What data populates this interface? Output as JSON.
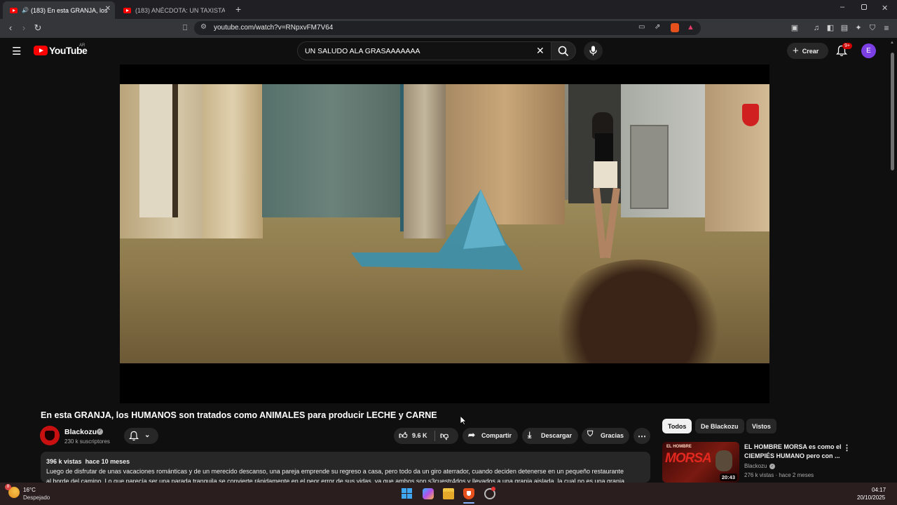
{
  "browser": {
    "tabs": [
      {
        "label": "(183) En esta GRANJA, los HU..."
      },
      {
        "label": "(183) ANÉCDOTA: UN TAXISTA MUY ..."
      }
    ],
    "url": "youtube.com/watch?v=RNpxvFM7V64"
  },
  "youtube": {
    "logo_text": "YouTube",
    "region": "AR",
    "search_query": "UN SALUDO ALA GRASAAAAAAA",
    "create_label": "Crear",
    "notif_badge": "9+",
    "avatar_letter": "E"
  },
  "video": {
    "title": "En esta GRANJA, los HUMANOS son tratados como ANIMALES para producir LECHE y CARNE",
    "channel": "Blackozu",
    "subscribers": "230 k suscriptores",
    "likes": "9.6 K",
    "share_label": "Compartir",
    "download_label": "Descargar",
    "thanks_label": "Gracias",
    "views": "396 k vistas",
    "date": "hace 10 meses",
    "description_line1": "Luego de disfrutar de unas vacaciones románticas y de un merecido descanso, una pareja emprende su regreso a casa, pero todo da un giro aterrador, cuando deciden detenerse en un pequeño restaurante",
    "description_line2": "al borde del camino. Lo que parecía ser una parada tranquila se convierte rápidamente en el peor error de sus vidas, ya que ambos son s3cuestr4dos y llevados a una granja aislada, la cual no es una granja"
  },
  "sidebar": {
    "chips": [
      "Todos",
      "De Blackozu",
      "Vistos"
    ],
    "recommendation": {
      "title": "EL HOMBRE MORSA es como el CIEMPIÉS HUMANO pero con ...",
      "channel": "Blackozu",
      "meta": "276 k vistas · hace 2 meses",
      "duration": "20:43",
      "thumb_text": "MORSA",
      "thumb_text_small": "EL HOMBRE"
    }
  },
  "taskbar": {
    "temperature": "16°C",
    "weather": "Despejado",
    "weather_badge": "8",
    "time": "04:17",
    "date": "20/10/2025"
  },
  "colors": {
    "youtube_red": "#ff0000",
    "avatar_purple": "#7b3fe4",
    "background": "#0f0f0f"
  }
}
